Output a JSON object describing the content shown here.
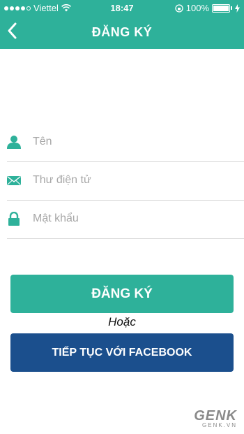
{
  "status_bar": {
    "carrier": "Viettel",
    "time": "18:47",
    "battery_percent": "100%",
    "battery_level": 1.0
  },
  "header": {
    "title": "ĐĂNG KÝ",
    "back_icon": "chevron-left-icon"
  },
  "form": {
    "name_placeholder": "Tên",
    "name_value": "",
    "email_placeholder": "Thư điện tử",
    "email_value": "",
    "password_placeholder": "Mật khẩu",
    "password_value": ""
  },
  "actions": {
    "register_label": "ĐĂNG KÝ",
    "or_label": "Hoặc",
    "facebook_label": "TIẾP TỤC VỚI FACEBOOK"
  },
  "watermark": {
    "logo": "GENK",
    "site": "GENK.VN"
  },
  "colors": {
    "primary": "#2eb19a",
    "facebook": "#1b4f8d",
    "icon": "#2eb19a"
  }
}
